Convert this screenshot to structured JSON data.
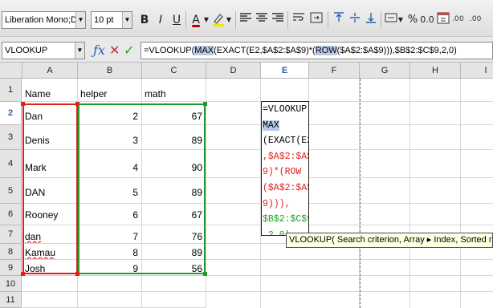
{
  "toolbar": {
    "font_name": "Liberation Mono;Deja",
    "font_size": "10 pt",
    "bold_label": "B",
    "italic_label": "I",
    "underline_label": "U",
    "font_color_label": "A",
    "percent_label": "%",
    "number_label": "0.0"
  },
  "formula_bar": {
    "name_box": "VLOOKUP",
    "formula_parts": [
      "=VLOOKUP(",
      "MAX",
      "(EXACT(E2,$A$2:$A$9)*(",
      "ROW",
      "($A$2:$A$9))),$B$2:$C$9,2,0)"
    ]
  },
  "columns": [
    "A",
    "B",
    "C",
    "D",
    "E",
    "F",
    "G",
    "H",
    "I"
  ],
  "rows": [
    "1",
    "2",
    "3",
    "4",
    "5",
    "6",
    "7",
    "8",
    "9",
    "10",
    "11"
  ],
  "headers": {
    "a": "Name",
    "b": "helper",
    "c": "math"
  },
  "table": [
    {
      "name": "Dan",
      "helper": "2",
      "math": "67"
    },
    {
      "name": "Denis",
      "helper": "3",
      "math": "89"
    },
    {
      "name": "Mark",
      "helper": "4",
      "math": "90"
    },
    {
      "name": "DAN",
      "helper": "5",
      "math": "89"
    },
    {
      "name": "Rooney",
      "helper": "6",
      "math": "67"
    },
    {
      "name": "dan",
      "helper": "7",
      "math": "76"
    },
    {
      "name": "Kamau",
      "helper": "8",
      "math": "89"
    },
    {
      "name": "Josh",
      "helper": "9",
      "math": "56"
    }
  ],
  "edit_lines": [
    "=VLOOKUP(",
    "MAX",
    "(EXACT(E2",
    ",$A$2:$A$",
    "9)*(ROW",
    "($A$2:$A$",
    "9))),",
    "$B$2:$C$9",
    ",2,0)"
  ],
  "tooltip": "VLOOKUP( Search criterion, Array ▸ Index, Sorted range lookup )",
  "colors": {
    "accent": "#2a5fb4",
    "range_a": "#e2201b",
    "range_b": "#1f9a2a"
  }
}
